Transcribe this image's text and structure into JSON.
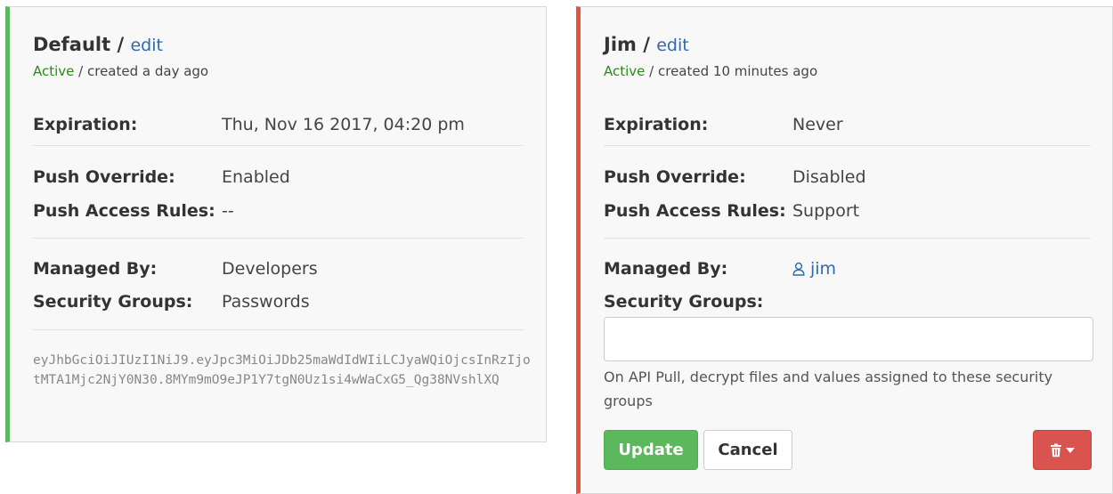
{
  "cards": [
    {
      "name": "Default",
      "edit_label": "edit",
      "status": "Active",
      "created": " / created a day ago",
      "expiration_label": "Expiration:",
      "expiration_value": "Thu, Nov 16 2017, 04:20 pm",
      "push_override_label": "Push Override:",
      "push_override_value": "Enabled",
      "push_access_label": "Push Access Rules:",
      "push_access_value": "--",
      "managed_by_label": "Managed By:",
      "managed_by_value": "Developers",
      "security_groups_label": "Security Groups:",
      "security_groups_value": "Passwords",
      "token": "eyJhbGciOiJIUzI1NiJ9.eyJpc3MiOiJDb25maWdIdWIiLCJyaWQiOjcsInRzIjotMTA1Mjc2NjY0N30.8MYm9mO9eJP1Y7tgN0Uz1si4wWaCxG5_Qg38NVshlXQ",
      "accent_color": "#5cb85c"
    },
    {
      "name": "Jim",
      "edit_label": "edit",
      "status": "Active",
      "created": " / created 10 minutes ago",
      "expiration_label": "Expiration:",
      "expiration_value": "Never",
      "push_override_label": "Push Override:",
      "push_override_value": "Disabled",
      "push_access_label": "Push Access Rules:",
      "push_access_value": "Support",
      "managed_by_label": "Managed By:",
      "managed_by_icon": "user-icon",
      "managed_by_value": "jim",
      "security_groups_label": "Security Groups:",
      "security_groups_input_value": "",
      "help_text": "On API Pull, decrypt files and values assigned to these security groups",
      "update_label": "Update",
      "cancel_label": "Cancel",
      "delete_icon": "trash-icon",
      "accent_color": "#e9523f"
    }
  ]
}
